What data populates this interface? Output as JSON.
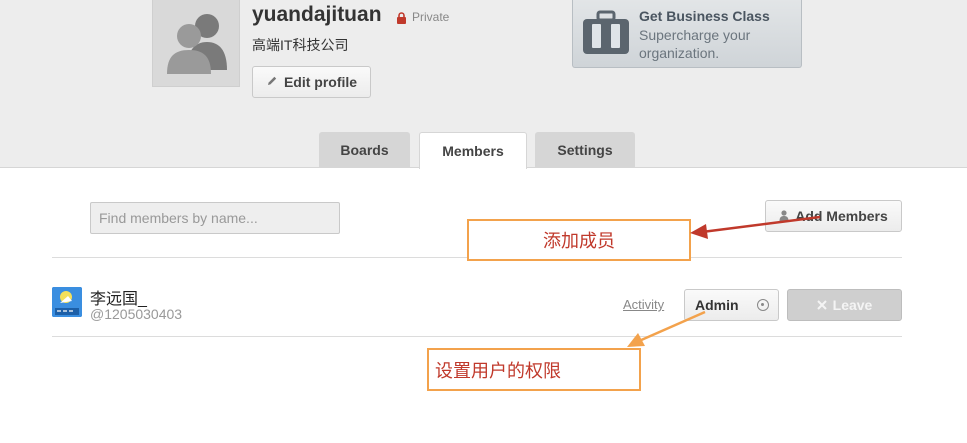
{
  "header": {
    "org_name": "yuandajituan",
    "privacy_label": "Private",
    "org_description": "高端IT科技公司",
    "edit_profile_label": "Edit profile"
  },
  "business_promo": {
    "title": "Get Business Class",
    "subtitle": "Supercharge your organization."
  },
  "tabs": [
    {
      "label": "Boards",
      "active": false
    },
    {
      "label": "Members",
      "active": true
    },
    {
      "label": "Settings",
      "active": false
    }
  ],
  "members_panel": {
    "search_placeholder": "Find members by name...",
    "add_members_label": "Add Members",
    "members": [
      {
        "name": "李远国_",
        "handle": "@1205030403",
        "activity_label": "Activity",
        "role": "Admin",
        "leave_label": "Leave"
      }
    ]
  },
  "annotations": {
    "add_member_note": "添加成员",
    "permission_note": "设置用户的权限",
    "accent_color": "#f3a24c",
    "arrow_color_1": "#c0392b",
    "arrow_color_2": "#f3a24c"
  },
  "icons": [
    "user-silhouette-icon",
    "lock-icon",
    "pencil-icon",
    "briefcase-icon",
    "person-icon",
    "chevron-circle-icon",
    "close-icon"
  ]
}
